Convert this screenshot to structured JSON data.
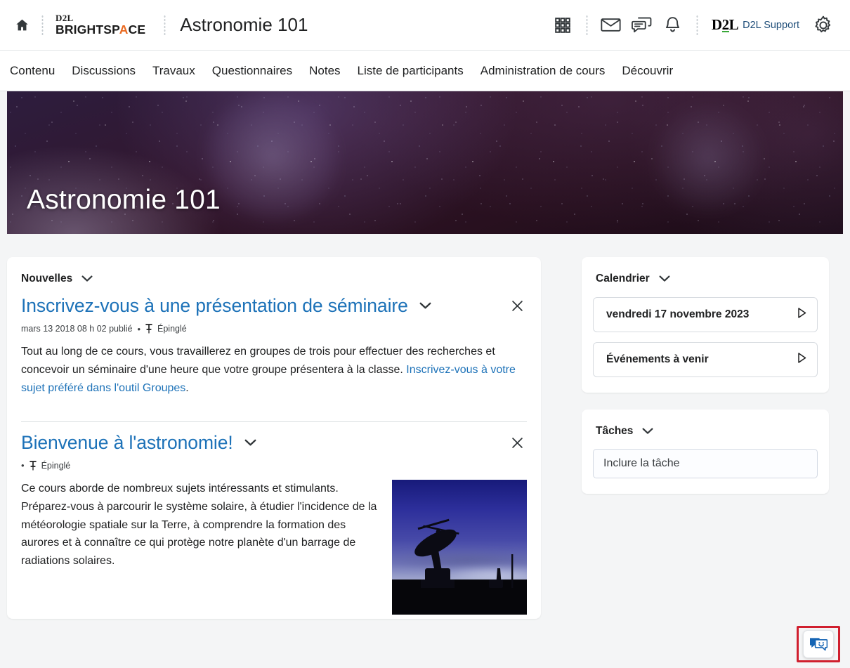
{
  "header": {
    "home_icon": "home-icon",
    "brand_top": "D2L",
    "brand_bottom_pre": "BRIGHTSP",
    "brand_bottom_accent": "A",
    "brand_bottom_post": "CE",
    "course_title": "Astronomie 101",
    "waffle_icon": "grid-apps-icon",
    "email_icon": "envelope-icon",
    "chat_icon": "chat-bubbles-icon",
    "bell_icon": "bell-icon",
    "d2l_mark_d": "D",
    "d2l_mark_2": "2",
    "d2l_mark_l": "L",
    "support_label": "D2L Support",
    "settings_icon": "gear-icon"
  },
  "nav": {
    "items": [
      {
        "label": "Contenu"
      },
      {
        "label": "Discussions"
      },
      {
        "label": "Travaux"
      },
      {
        "label": "Questionnaires"
      },
      {
        "label": "Notes"
      },
      {
        "label": "Liste de participants"
      },
      {
        "label": "Administration de cours"
      },
      {
        "label": "Découvrir"
      }
    ]
  },
  "banner": {
    "title": "Astronomie 101",
    "image_alt": "starfield-night-sky"
  },
  "news": {
    "widget_title": "Nouvelles",
    "chevron_icon": "chevron-down-icon",
    "items": [
      {
        "title": "Inscrivez-vous à une présentation de séminaire",
        "date": "mars 13 2018 08 h 02 publié",
        "bullet": "•",
        "pin_icon": "pin-icon",
        "pin_label": "Épinglé",
        "body_before_link": "Tout au long de ce cours, vous travaillerez en groupes de trois pour effectuer des recherches et concevoir un séminaire d'une heure que votre groupe présentera à la classe. ",
        "link_text": "Inscrivez-vous à votre sujet préféré dans l'outil Groupes",
        "body_after_link": ".",
        "close_icon": "close-icon",
        "chevron_icon": "chevron-down-icon"
      },
      {
        "title": "Bienvenue à l'astronomie!",
        "date": "",
        "bullet": "•",
        "pin_icon": "pin-icon",
        "pin_label": "Épinglé",
        "body": "Ce cours aborde de nombreux sujets intéressants et stimulants. Préparez-vous à parcourir le système solaire, à étudier l'incidence de la météorologie spatiale sur la Terre, à comprendre la formation des aurores et à connaître ce qui protège notre planète d'un barrage de radiations solaires.",
        "image_alt": "satellite-dish-at-dusk",
        "close_icon": "close-icon",
        "chevron_icon": "chevron-down-icon"
      }
    ]
  },
  "calendar": {
    "widget_title": "Calendrier",
    "chevron_icon": "chevron-down-icon",
    "rows": [
      {
        "label": "vendredi 17 novembre 2023",
        "arrow_icon": "play-triangle-icon"
      },
      {
        "label": "Événements à venir",
        "arrow_icon": "play-triangle-icon"
      }
    ]
  },
  "tasks": {
    "widget_title": "Tâches",
    "chevron_icon": "chevron-down-icon",
    "input_placeholder": "Inclure la tâche",
    "input_value": ""
  },
  "chat_widget": {
    "icon": "chat-support-icon",
    "highlight_color": "#d01f2e"
  },
  "colors": {
    "link": "#1d72b8",
    "page_bg": "#f4f5f6",
    "card_bg": "#ffffff",
    "brand_accent": "#ea6a20",
    "d2l_green": "#3aa83a"
  }
}
